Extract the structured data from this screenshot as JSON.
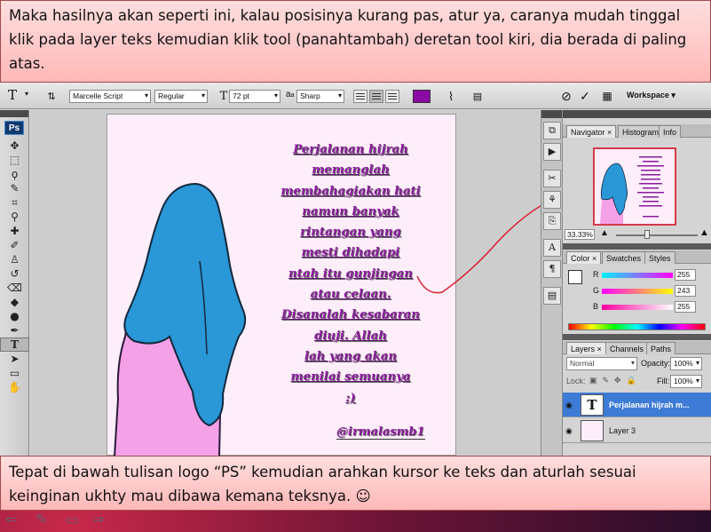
{
  "captions": {
    "top": "Maka hasilnya akan seperti ini, kalau posisinya kurang pas, atur ya, caranya mudah tinggal klik pada layer teks kemudian klik tool (panahtambah) deretan tool kiri, dia berada di paling atas.",
    "bottom": "Tepat di bawah tulisan logo “PS” kemudian arahkan kursor ke teks dan aturlah sesuai keinginan ukhty mau dibawa kemana teksnya. ☺"
  },
  "options_bar": {
    "tool_icon": "T",
    "font_family": "Marcelle Script",
    "font_style": "Regular",
    "font_size": "72 pt",
    "aa_prefix": "a",
    "aa_label": "a",
    "anti_alias": "Sharp",
    "workspace": "Workspace ▾",
    "cancel_glyph": "⊘",
    "commit_glyph": "✓",
    "text_color": "#8b0aa6"
  },
  "toolbox": {
    "logo": "Ps",
    "tools": [
      "move-tool",
      "marquee-tool",
      "lasso-tool",
      "magic-wand-tool",
      "crop-tool",
      "eyedropper-tool",
      "healing-brush-tool",
      "brush-tool",
      "clone-stamp-tool",
      "history-brush-tool",
      "eraser-tool",
      "paint-bucket-tool",
      "dodge-tool",
      "pen-tool",
      "type-tool",
      "path-selection-tool",
      "shape-tool"
    ]
  },
  "document": {
    "poem_lines": [
      "Perjalanan hijrah",
      "memanglah",
      "membahagiakan hati",
      "namun banyak",
      "rintangan yang",
      "mesti dihadapi",
      "ntah itu gunjingan",
      "atau celaan.",
      "Disanalah kesabaran",
      "diuji. Allah",
      "lah yang akan",
      "menilai semuanya",
      ":)"
    ],
    "signature": "@irmalasmb1",
    "hijab_color": "#2a97d7",
    "dress_color": "#f4a1e8"
  },
  "navigator": {
    "tabs": [
      "Navigator",
      "Histogram",
      "Info"
    ],
    "zoom": "33.33%"
  },
  "color_panel": {
    "tabs": [
      "Color",
      "Swatches",
      "Styles"
    ],
    "channels": [
      {
        "label": "R",
        "value": "255"
      },
      {
        "label": "G",
        "value": "243"
      },
      {
        "label": "B",
        "value": "255"
      }
    ]
  },
  "layers_panel": {
    "tabs": [
      "Layers",
      "Channels",
      "Paths"
    ],
    "blend_mode": "Normal",
    "opacity_label": "Opacity:",
    "opacity": "100%",
    "lock_label": "Lock:",
    "fill_label": "Fill:",
    "fill": "100%",
    "layers": [
      {
        "name": "Perjalanan hijrah m...",
        "thumb": "T",
        "selected": true
      },
      {
        "name": "Layer 3",
        "thumb": "",
        "selected": false
      }
    ]
  }
}
